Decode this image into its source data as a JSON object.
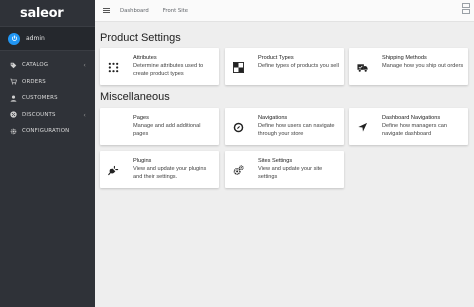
{
  "brand": {
    "logo": "saleor"
  },
  "user": {
    "name": "admin"
  },
  "sidebar": {
    "items": [
      {
        "label": "CATALOG",
        "icon": "tag-icon",
        "has_submenu": true
      },
      {
        "label": "ORDERS",
        "icon": "cart-icon",
        "has_submenu": false
      },
      {
        "label": "CUSTOMERS",
        "icon": "person-icon",
        "has_submenu": false
      },
      {
        "label": "DISCOUNTS",
        "icon": "discount-icon",
        "has_submenu": true
      },
      {
        "label": "CONFIGURATION",
        "icon": "gear-icon",
        "has_submenu": false
      }
    ]
  },
  "topbar": {
    "links": [
      "Dashboard",
      "Front Site"
    ]
  },
  "sections": [
    {
      "title": "Product Settings",
      "cards": [
        {
          "title": "Attributes",
          "description": "Determine attributes used to create product types",
          "icon": "attributes-icon"
        },
        {
          "title": "Product Types",
          "description": "Define types of products you sell",
          "icon": "product-types-icon"
        },
        {
          "title": "Shipping Methods",
          "description": "Manage how you ship out orders",
          "icon": "truck-icon"
        }
      ]
    },
    {
      "title": "Miscellaneous",
      "cards": [
        {
          "title": "Pages",
          "description": "Manage and add additional pages",
          "icon": "pages-icon"
        },
        {
          "title": "Navigations",
          "description": "Define how users can navigate through your store",
          "icon": "compass-icon"
        },
        {
          "title": "Dashboard Navigations",
          "description": "Define how managers can navigate dashboard",
          "icon": "navigation-arrow-icon"
        },
        {
          "title": "Plugins",
          "description": "View and update your plugins and their settings.",
          "icon": "plug-icon"
        },
        {
          "title": "Sites Settings",
          "description": "View and update your site settings",
          "icon": "gears-icon"
        }
      ]
    }
  ],
  "colors": {
    "sidebar_bg": "#2f3238",
    "avatar": "#2196f3",
    "content_bg": "#eeeeee"
  }
}
